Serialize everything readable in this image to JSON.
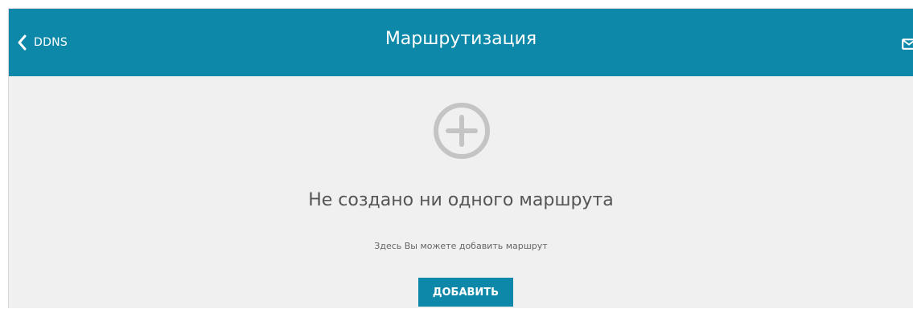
{
  "header": {
    "back_label": "DDNS",
    "title": "Маршрутизация",
    "back_icon": "chevron-left-icon",
    "mail_icon": "envelope-icon"
  },
  "empty_state": {
    "icon": "add-circle-icon",
    "title": "Не создано ни одного маршрута",
    "subtitle": "Здесь Вы можете добавить маршрут",
    "add_button_label": "ДОБАВИТЬ"
  },
  "colors": {
    "accent": "#0e88a8",
    "background": "#f0f0f0",
    "icon_gray": "#c4c4c4",
    "title_text": "#555555"
  }
}
